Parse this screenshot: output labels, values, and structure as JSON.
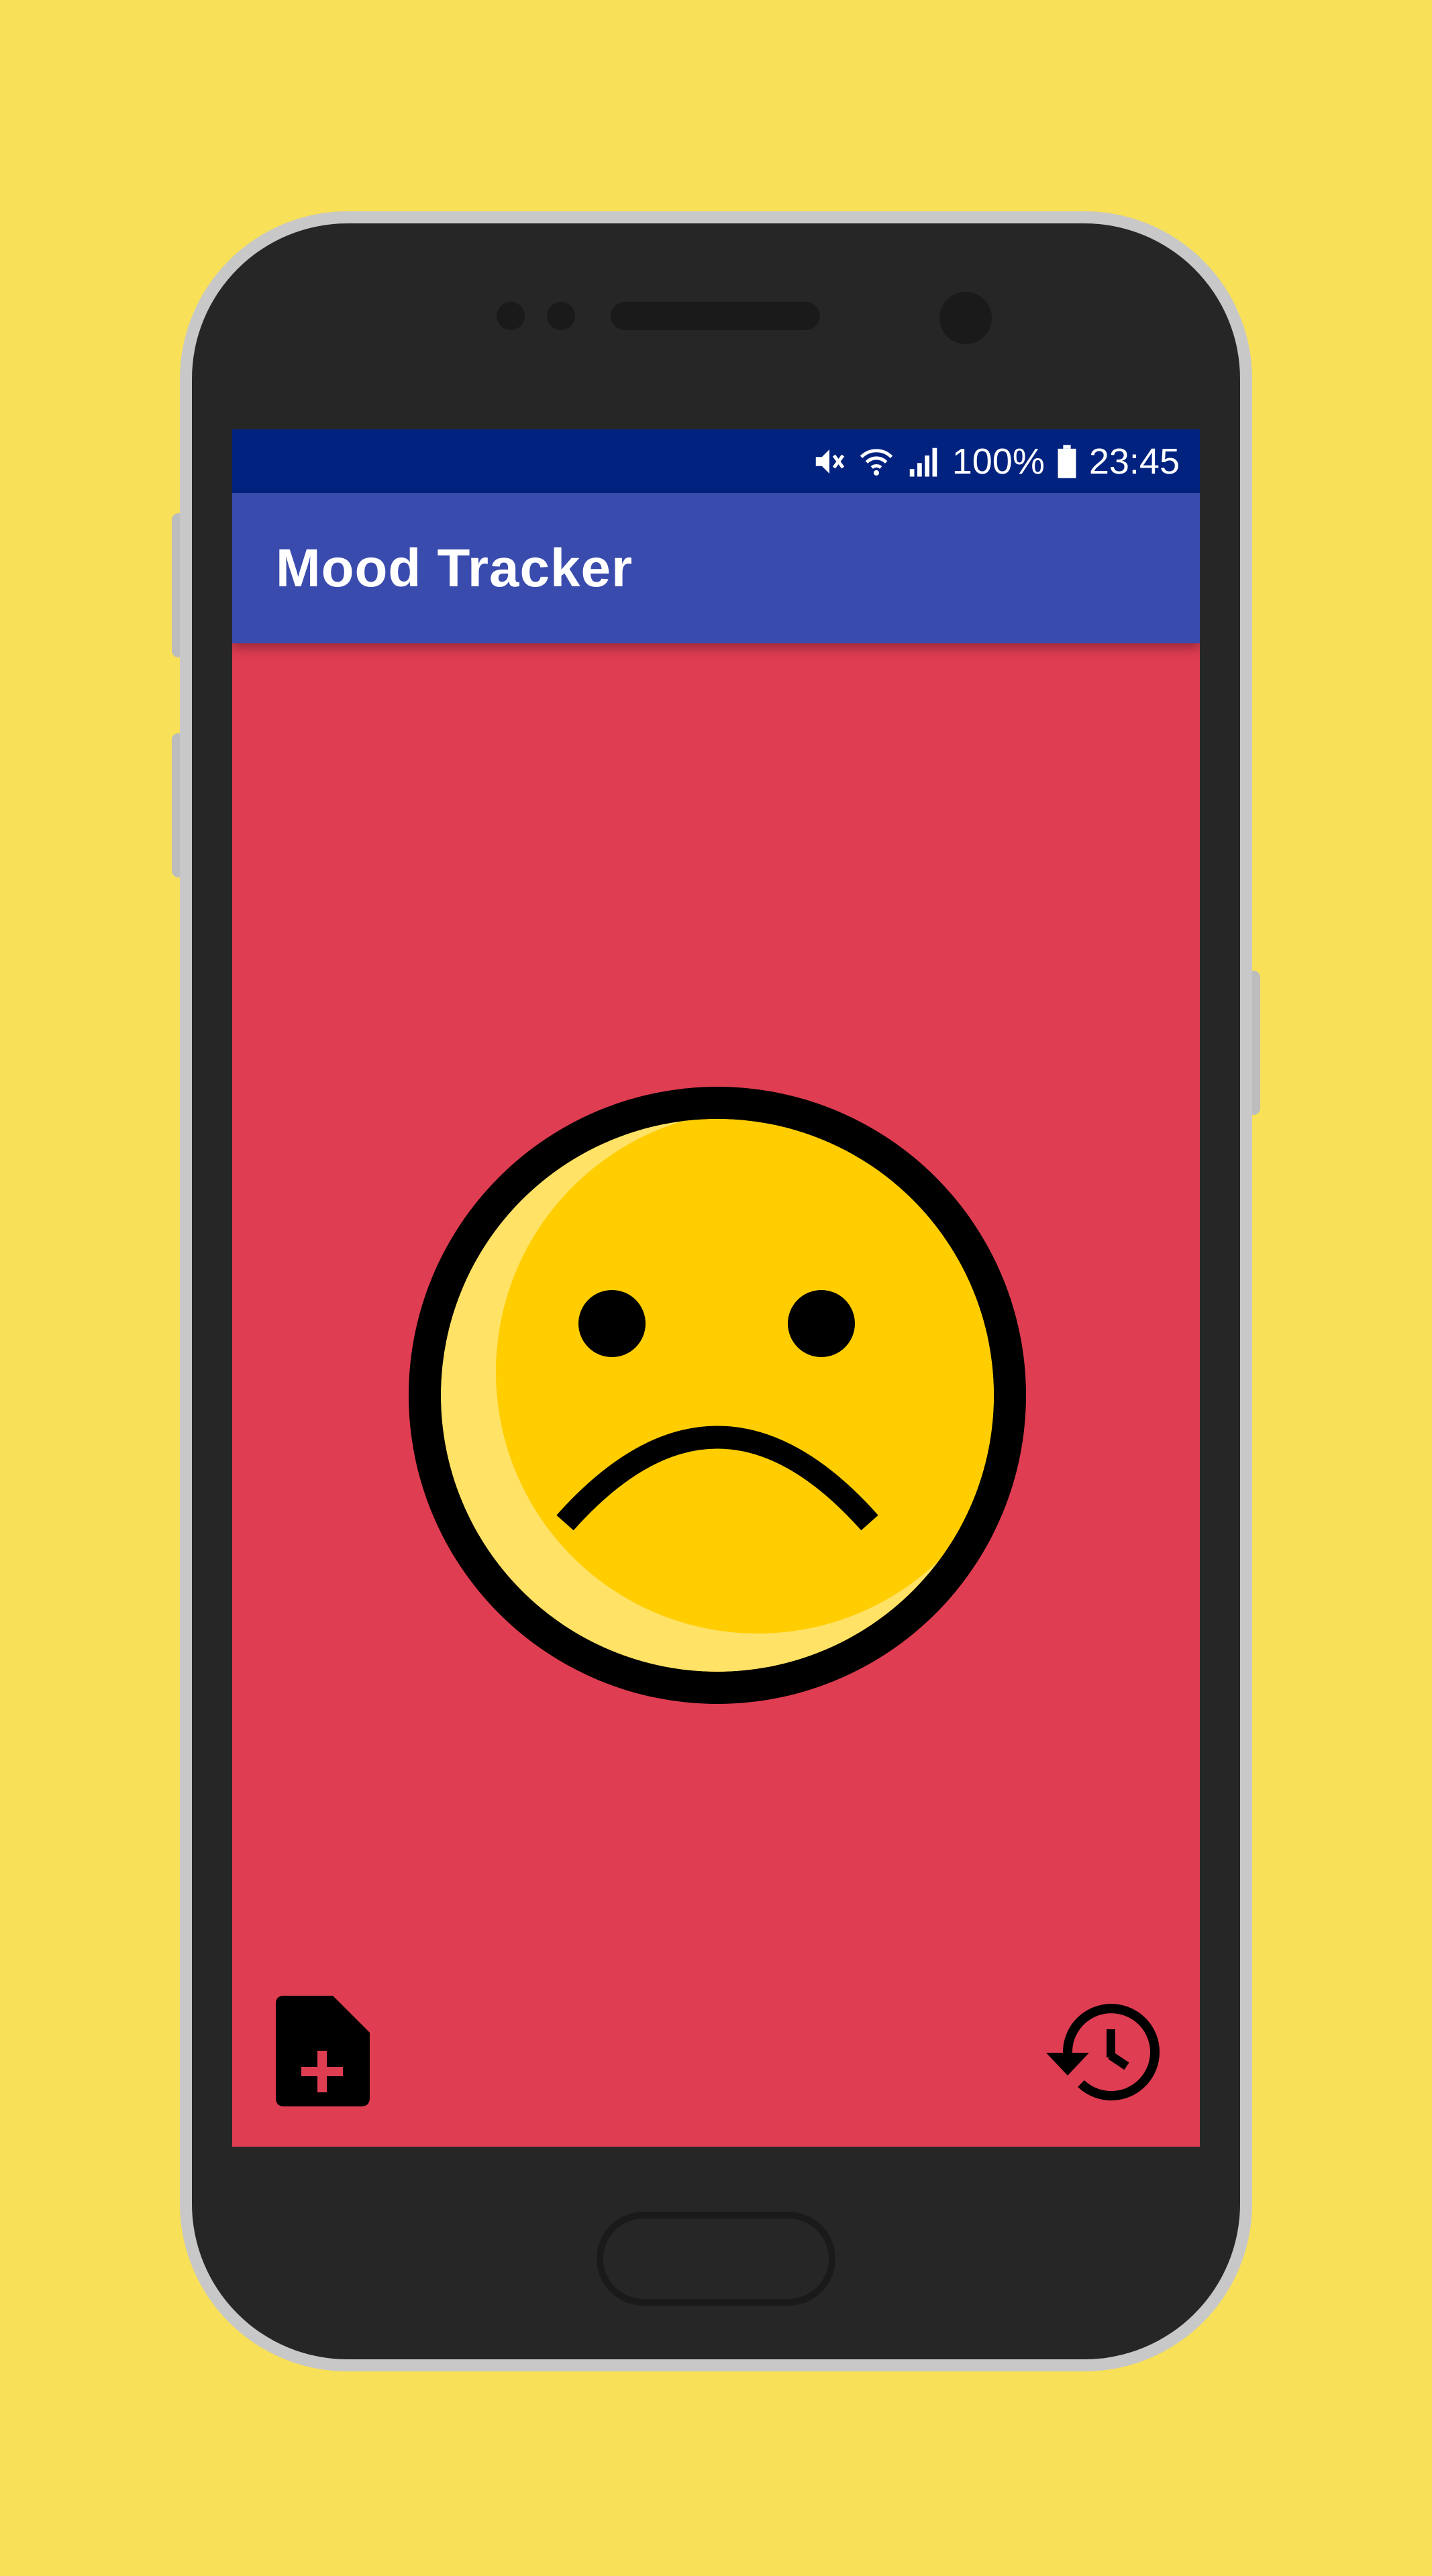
{
  "status_bar": {
    "icons": [
      "mute-icon",
      "wifi-icon",
      "signal-icon",
      "battery-icon"
    ],
    "battery_text": "100%",
    "time": "23:45"
  },
  "app_bar": {
    "title": "Mood Tracker"
  },
  "main": {
    "background_color": "#df3d52",
    "current_mood": "sad",
    "mood_icon": "sad-face-icon"
  },
  "actions": {
    "add_note_icon": "add-note-icon",
    "history_icon": "history-icon"
  },
  "colors": {
    "background": "#f8e058",
    "status_bar": "#01227f",
    "app_bar": "#3a4bae",
    "screen_sad": "#df3d52",
    "face_fill": "#ffcd00",
    "face_shadow": "#ffad00"
  }
}
